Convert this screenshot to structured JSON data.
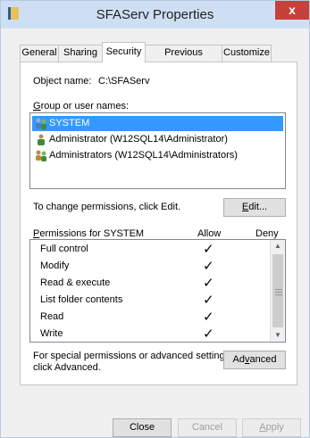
{
  "window": {
    "title": "SFAServ Properties",
    "close_glyph": "x"
  },
  "tabs": [
    {
      "label": "General"
    },
    {
      "label": "Sharing"
    },
    {
      "label": "Security"
    },
    {
      "label": "Previous Versions"
    },
    {
      "label": "Customize"
    }
  ],
  "object": {
    "label": "Object name:",
    "value": "C:\\SFAServ"
  },
  "groups": {
    "label_prefix": "",
    "label_accel": "G",
    "label_rest": "roup or user names:",
    "users": [
      {
        "name": "SYSTEM",
        "icon": "users-group-icon",
        "selected": true
      },
      {
        "name": "Administrator (W12SQL14\\Administrator)",
        "icon": "user-icon",
        "selected": false
      },
      {
        "name": "Administrators (W12SQL14\\Administrators)",
        "icon": "users-group-icon",
        "selected": false
      }
    ]
  },
  "change_text": "To change permissions, click Edit.",
  "edit_button": {
    "accel": "E",
    "rest": "dit..."
  },
  "permissions": {
    "label_accel": "P",
    "label_rest": "ermissions for SYSTEM",
    "allow_header": "Allow",
    "deny_header": "Deny",
    "rows": [
      {
        "name": "Full control",
        "allow": "✓",
        "deny": ""
      },
      {
        "name": "Modify",
        "allow": "✓",
        "deny": ""
      },
      {
        "name": "Read & execute",
        "allow": "✓",
        "deny": ""
      },
      {
        "name": "List folder contents",
        "allow": "✓",
        "deny": ""
      },
      {
        "name": "Read",
        "allow": "✓",
        "deny": ""
      },
      {
        "name": "Write",
        "allow": "✓",
        "deny": ""
      }
    ]
  },
  "advanced_text": {
    "line1": "For special permissions or advanced settings,",
    "line2": "click Advanced."
  },
  "advanced_button": {
    "pre": "Ad",
    "accel": "v",
    "rest": "anced"
  },
  "footer": {
    "close": "Close",
    "cancel": "Cancel",
    "apply_accel": "A",
    "apply_rest": "pply"
  },
  "colors": {
    "selection": "#3399ff",
    "title_bg": "#cfdff3",
    "close_bg": "#c7403a"
  }
}
